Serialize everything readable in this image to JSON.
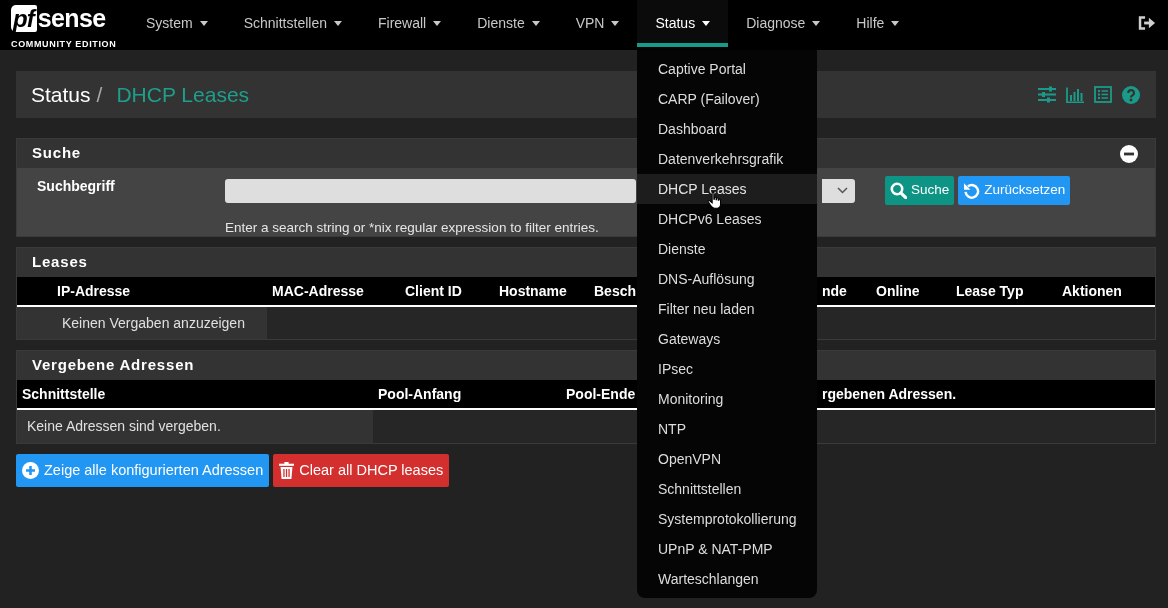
{
  "navbar": {
    "logo": {
      "mark": "pf",
      "name": "sense",
      "edition": "COMMUNITY EDITION"
    },
    "menus": [
      {
        "label": "System",
        "selected": false
      },
      {
        "label": "Schnittstellen",
        "selected": false
      },
      {
        "label": "Firewall",
        "selected": false
      },
      {
        "label": "Dienste",
        "selected": false
      },
      {
        "label": "VPN",
        "selected": false
      },
      {
        "label": "Status",
        "selected": true,
        "items": [
          {
            "label": "Captive Portal",
            "highlighted": false
          },
          {
            "label": "CARP (Failover)",
            "highlighted": false
          },
          {
            "label": "Dashboard",
            "highlighted": false
          },
          {
            "label": "Datenverkehrsgrafik",
            "highlighted": false
          },
          {
            "label": "DHCP Leases",
            "highlighted": true
          },
          {
            "label": "DHCPv6 Leases",
            "highlighted": false
          },
          {
            "label": "Dienste",
            "highlighted": false
          },
          {
            "label": "DNS-Auflösung",
            "highlighted": false
          },
          {
            "label": "Filter neu laden",
            "highlighted": false
          },
          {
            "label": "Gateways",
            "highlighted": false
          },
          {
            "label": "IPsec",
            "highlighted": false
          },
          {
            "label": "Monitoring",
            "highlighted": false
          },
          {
            "label": "NTP",
            "highlighted": false
          },
          {
            "label": "OpenVPN",
            "highlighted": false
          },
          {
            "label": "Schnittstellen",
            "highlighted": false
          },
          {
            "label": "Systemprotokollierung",
            "highlighted": false
          },
          {
            "label": "UPnP & NAT-PMP",
            "highlighted": false
          },
          {
            "label": "Warteschlangen",
            "highlighted": false
          }
        ]
      },
      {
        "label": "Diagnose",
        "selected": false
      },
      {
        "label": "Hilfe",
        "selected": false
      }
    ]
  },
  "page_header": {
    "breadcrumb": [
      {
        "label": "Status"
      },
      {
        "label": "DHCP Leases"
      }
    ],
    "separator": "/"
  },
  "search_panel": {
    "title": "Suche",
    "collapsible": true,
    "field_label": "Suchbegriff",
    "help": "Enter a search string or *nix regular expression to filter entries.",
    "buttons": [
      {
        "label": "Suche",
        "kind": "search"
      },
      {
        "label": "Zurücksetzen",
        "kind": "reset"
      }
    ]
  },
  "leases_panel": {
    "title": "Leases",
    "columns": [
      "IP-Adresse",
      "MAC-Adresse",
      "Client ID",
      "Hostname",
      "Besch",
      "nde",
      "Online",
      "Lease Typ",
      "Aktionen"
    ],
    "empty_message": "Keinen Vergaben anzuzeigen"
  },
  "pools_panel": {
    "title": "Vergebene Adressen",
    "columns": [
      "Schnittstelle",
      "Pool-Anfang",
      "Pool-Ende",
      "rgebenen Adressen."
    ],
    "empty_message": "Keine Adressen sind vergeben."
  },
  "actions": [
    {
      "label": "Zeige alle konfigurierten Adressen",
      "kind": "show_all"
    },
    {
      "label": "Clear all DHCP leases",
      "kind": "clear"
    }
  ]
}
